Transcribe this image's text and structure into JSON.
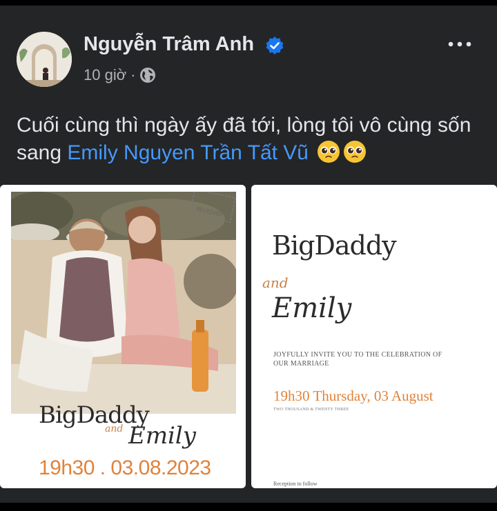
{
  "post": {
    "author": "Nguyễn Trâm Anh",
    "timestamp": "10 giờ",
    "separator": "·",
    "caption_prefix": "Cuối cùng thì ngày ấy đã tới, lòng tôi vô cùng sốn sang ",
    "mention": "Emily Nguyen Trần Tất Vũ",
    "emoji": "pleading-face-emoji",
    "icons": {
      "verified": "verified-badge-icon",
      "audience": "globe-icon",
      "menu": "more-options-icon"
    },
    "colors": {
      "background": "#242526",
      "mention": "#4599ff",
      "verified": "#1877f2",
      "accent_orange": "#e0823a"
    }
  },
  "invitation_left": {
    "stamp_text": "RECEIVED",
    "name1": "BigDaddy",
    "conjunction": "and",
    "name2": "Emily",
    "date": "19h30 . 03.08.2023"
  },
  "invitation_right": {
    "name1": "BigDaddy",
    "conjunction": "and",
    "name2": "Emily",
    "invite_text": "JOYFULLY INVITE YOU TO THE CELEBRATION OF OUR MARRIAGE",
    "date": "19h30 Thursday, 03 August",
    "year_text": "TWO THOUSAND & TWENTY THREE",
    "reception": "Reception to follow"
  }
}
